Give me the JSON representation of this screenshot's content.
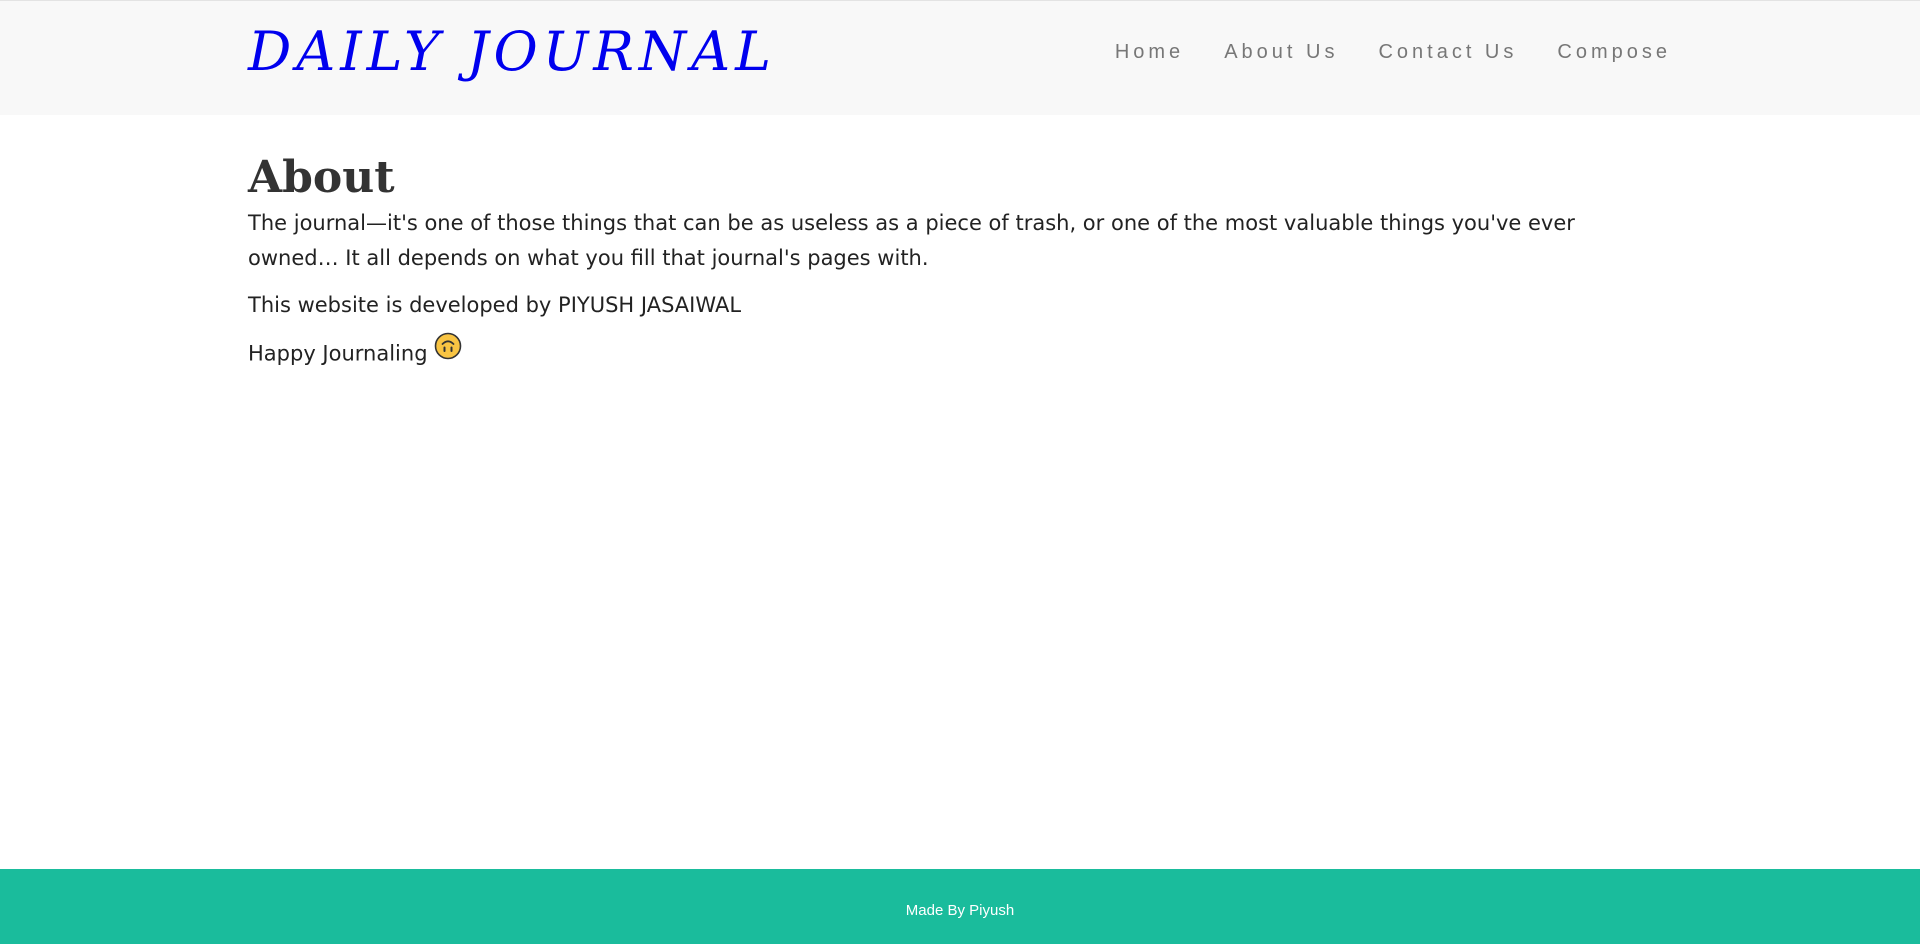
{
  "navbar": {
    "brand": "DAILY JOURNAL",
    "links": [
      {
        "label": "Home"
      },
      {
        "label": "About Us"
      },
      {
        "label": "Contact Us"
      },
      {
        "label": "Compose"
      }
    ]
  },
  "main": {
    "title": "About",
    "paragraphs": [
      "The journal—it's one of those things that can be as useless as a piece of trash, or one of the most valuable things you've ever owned… It all depends on what you fill that journal's pages with.",
      "This website is developed by PIYUSH JASAIWAL",
      "Happy Journaling"
    ],
    "emoji_icon": "upside-down-face-icon"
  },
  "footer": {
    "text": "Made By Piyush"
  },
  "colors": {
    "brand": "#0000ee",
    "navbar_bg": "#f8f8f8",
    "nav_link": "#777777",
    "heading": "#333333",
    "footer_bg": "#1abc9c",
    "footer_text": "#ffffff",
    "emoji": "#f8c443"
  }
}
